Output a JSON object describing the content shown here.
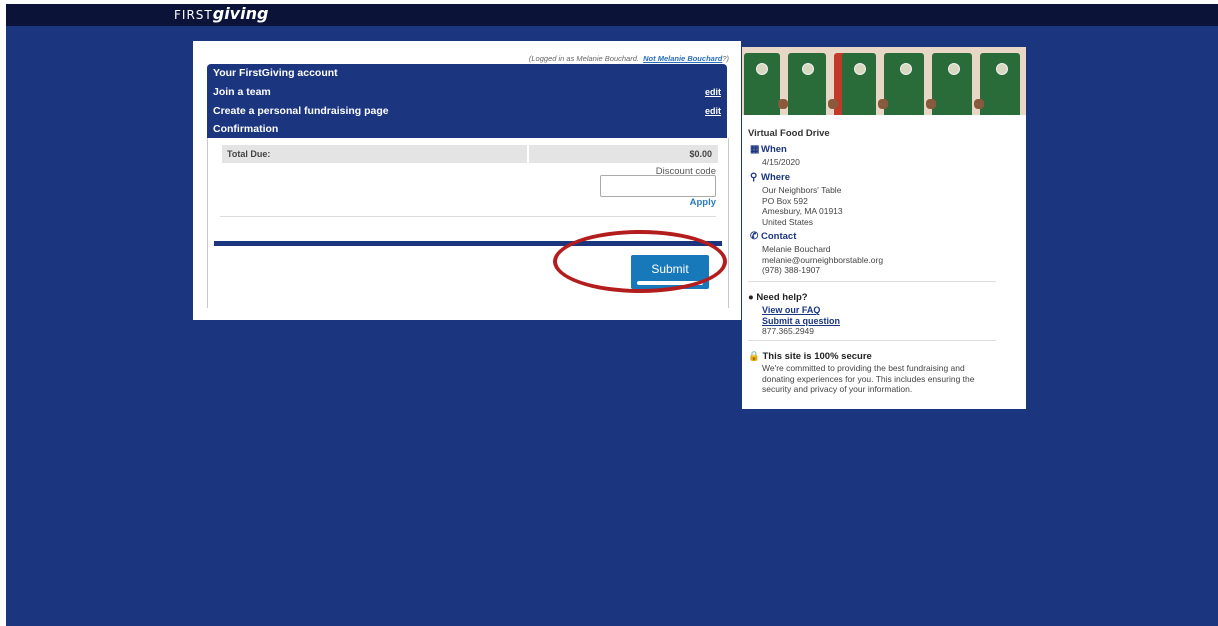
{
  "brand": {
    "logo_prefix": "FIRST",
    "logo_main": "giving"
  },
  "colors": {
    "background": "#1b357f",
    "topbar": "#0b1438",
    "accent": "#1779ba",
    "highlight_ring": "#b41d1d"
  },
  "header": {
    "logged_prefix": "(Logged in as Melanie Bouchard.",
    "not_user_link": "Not Melanie Bouchard",
    "logged_suffix": "?)"
  },
  "steps": [
    {
      "label": "Your FirstGiving account"
    },
    {
      "label": "Join a team",
      "edit": "edit"
    },
    {
      "label": "Create a personal fundraising page",
      "edit": "edit"
    },
    {
      "label": "Confirmation"
    }
  ],
  "summary": {
    "total_label": "Total Due:",
    "total_value": "$0.00"
  },
  "discount": {
    "label": "Discount code",
    "value": "",
    "apply": "Apply"
  },
  "submit": {
    "label": "Submit"
  },
  "sidebar": {
    "title": "Virtual Food Drive",
    "when": {
      "icon": "calendar-icon",
      "heading": "When",
      "value": "4/15/2020"
    },
    "where": {
      "icon": "location-pin-icon",
      "heading": "Where",
      "line1": "Our Neighbors' Table",
      "line2": "PO Box 592",
      "line3": "Amesbury, MA 01913",
      "line4": "United States"
    },
    "contact": {
      "icon": "phone-icon",
      "heading": "Contact",
      "name": "Melanie Bouchard",
      "email": "melanie@ourneighborstable.org",
      "phone": "(978) 388-1907"
    },
    "help": {
      "icon": "chat-bubble-icon",
      "heading": "Need help?",
      "faq": "View our FAQ",
      "question": "Submit a question",
      "phone": "877.365.2949"
    },
    "secure": {
      "icon": "lock-icon",
      "heading": "This site is 100% secure",
      "line1": "We're committed to providing the best fundraising and",
      "line2": "donating experiences for you. This includes ensuring the",
      "line3": "security and privacy of your information."
    }
  }
}
